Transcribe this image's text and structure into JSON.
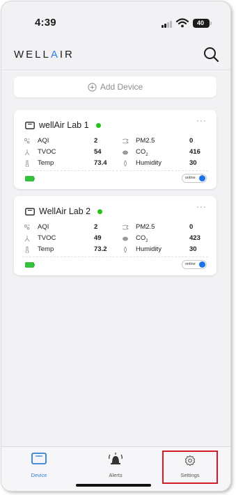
{
  "status_bar": {
    "time": "4:39",
    "battery": "40"
  },
  "header": {
    "logo_left": "WELL",
    "logo_mid": "A",
    "logo_right": "IR",
    "search_icon": "search-icon"
  },
  "add_device": {
    "label": "Add Device",
    "icon": "plus-circle-icon"
  },
  "devices": [
    {
      "name": "wellAir Lab 1",
      "status_color": "#25c21c",
      "metrics": {
        "aqi_label": "AQI",
        "aqi": "2",
        "pm25_label": "PM2.5",
        "pm25": "0",
        "tvoc_label": "TVOC",
        "tvoc": "54",
        "co2_label": "CO",
        "co2_sub": "2",
        "co2": "416",
        "temp_label": "Temp",
        "temp": "73.4",
        "humidity_label": "Humidity",
        "humidity": "30"
      },
      "online_label": "online"
    },
    {
      "name": "WellAir Lab 2",
      "status_color": "#25c21c",
      "metrics": {
        "aqi_label": "AQI",
        "aqi": "2",
        "pm25_label": "PM2.5",
        "pm25": "0",
        "tvoc_label": "TVOC",
        "tvoc": "49",
        "co2_label": "CO",
        "co2_sub": "2",
        "co2": "423",
        "temp_label": "Temp",
        "temp": "73.2",
        "humidity_label": "Humidity",
        "humidity": "30"
      },
      "online_label": "online"
    }
  ],
  "tabbar": {
    "device": "Device",
    "alerts": "Alerts",
    "settings": "Settings"
  },
  "colors": {
    "accent": "#2f7fd6",
    "online": "#25c21c",
    "toggle": "#1a73e8",
    "highlight_box": "#d11a2a"
  }
}
